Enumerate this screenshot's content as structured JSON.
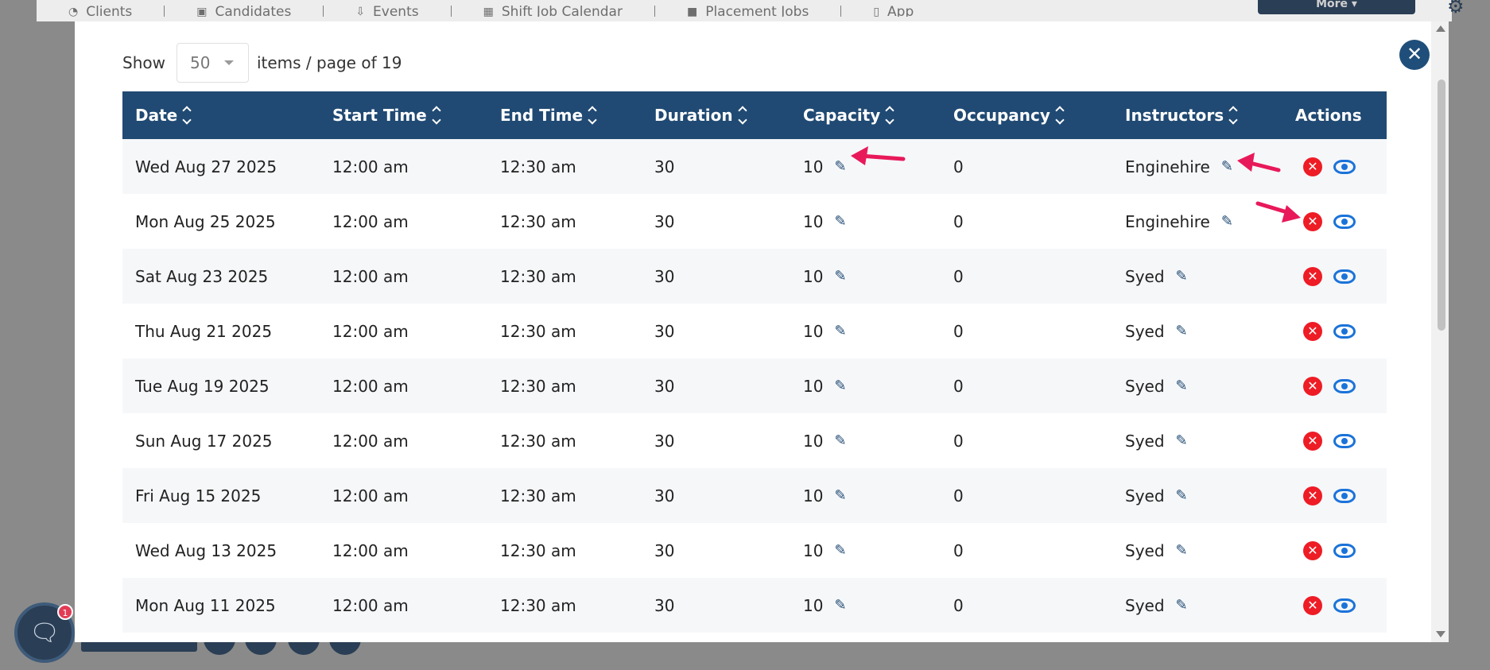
{
  "background_nav": {
    "items": [
      {
        "label": "Clients",
        "icon": "clients-icon"
      },
      {
        "label": "Candidates",
        "icon": "candidates-icon"
      },
      {
        "label": "Events",
        "icon": "events-icon"
      },
      {
        "label": "Shift Job Calendar",
        "icon": "calendar-icon"
      },
      {
        "label": "Placement Jobs",
        "icon": "briefcase-icon"
      },
      {
        "label": "App",
        "icon": "mobile-icon"
      }
    ],
    "more_label": "More"
  },
  "chat": {
    "badge_count": "1"
  },
  "modal": {
    "pager": {
      "show_label": "Show",
      "page_size": "50",
      "suffix": "items / page of 19"
    },
    "table": {
      "columns": [
        "Date",
        "Start Time",
        "End Time",
        "Duration",
        "Capacity",
        "Occupancy",
        "Instructors",
        "Actions"
      ],
      "rows": [
        {
          "date": "Wed Aug 27 2025",
          "start": "12:00 am",
          "end": "12:30 am",
          "duration": "30",
          "capacity": "10",
          "occupancy": "0",
          "instructor": "Enginehire"
        },
        {
          "date": "Mon Aug 25 2025",
          "start": "12:00 am",
          "end": "12:30 am",
          "duration": "30",
          "capacity": "10",
          "occupancy": "0",
          "instructor": "Enginehire"
        },
        {
          "date": "Sat Aug 23 2025",
          "start": "12:00 am",
          "end": "12:30 am",
          "duration": "30",
          "capacity": "10",
          "occupancy": "0",
          "instructor": "Syed"
        },
        {
          "date": "Thu Aug 21 2025",
          "start": "12:00 am",
          "end": "12:30 am",
          "duration": "30",
          "capacity": "10",
          "occupancy": "0",
          "instructor": "Syed"
        },
        {
          "date": "Tue Aug 19 2025",
          "start": "12:00 am",
          "end": "12:30 am",
          "duration": "30",
          "capacity": "10",
          "occupancy": "0",
          "instructor": "Syed"
        },
        {
          "date": "Sun Aug 17 2025",
          "start": "12:00 am",
          "end": "12:30 am",
          "duration": "30",
          "capacity": "10",
          "occupancy": "0",
          "instructor": "Syed"
        },
        {
          "date": "Fri Aug 15 2025",
          "start": "12:00 am",
          "end": "12:30 am",
          "duration": "30",
          "capacity": "10",
          "occupancy": "0",
          "instructor": "Syed"
        },
        {
          "date": "Wed Aug 13 2025",
          "start": "12:00 am",
          "end": "12:30 am",
          "duration": "30",
          "capacity": "10",
          "occupancy": "0",
          "instructor": "Syed"
        },
        {
          "date": "Mon Aug 11 2025",
          "start": "12:00 am",
          "end": "12:30 am",
          "duration": "30",
          "capacity": "10",
          "occupancy": "0",
          "instructor": "Syed"
        }
      ]
    }
  },
  "colors": {
    "header_bg": "#204a73",
    "cancel_red": "#ee1c25",
    "eye_blue": "#1a73d9",
    "annotation_arrow": "#e8195a"
  }
}
